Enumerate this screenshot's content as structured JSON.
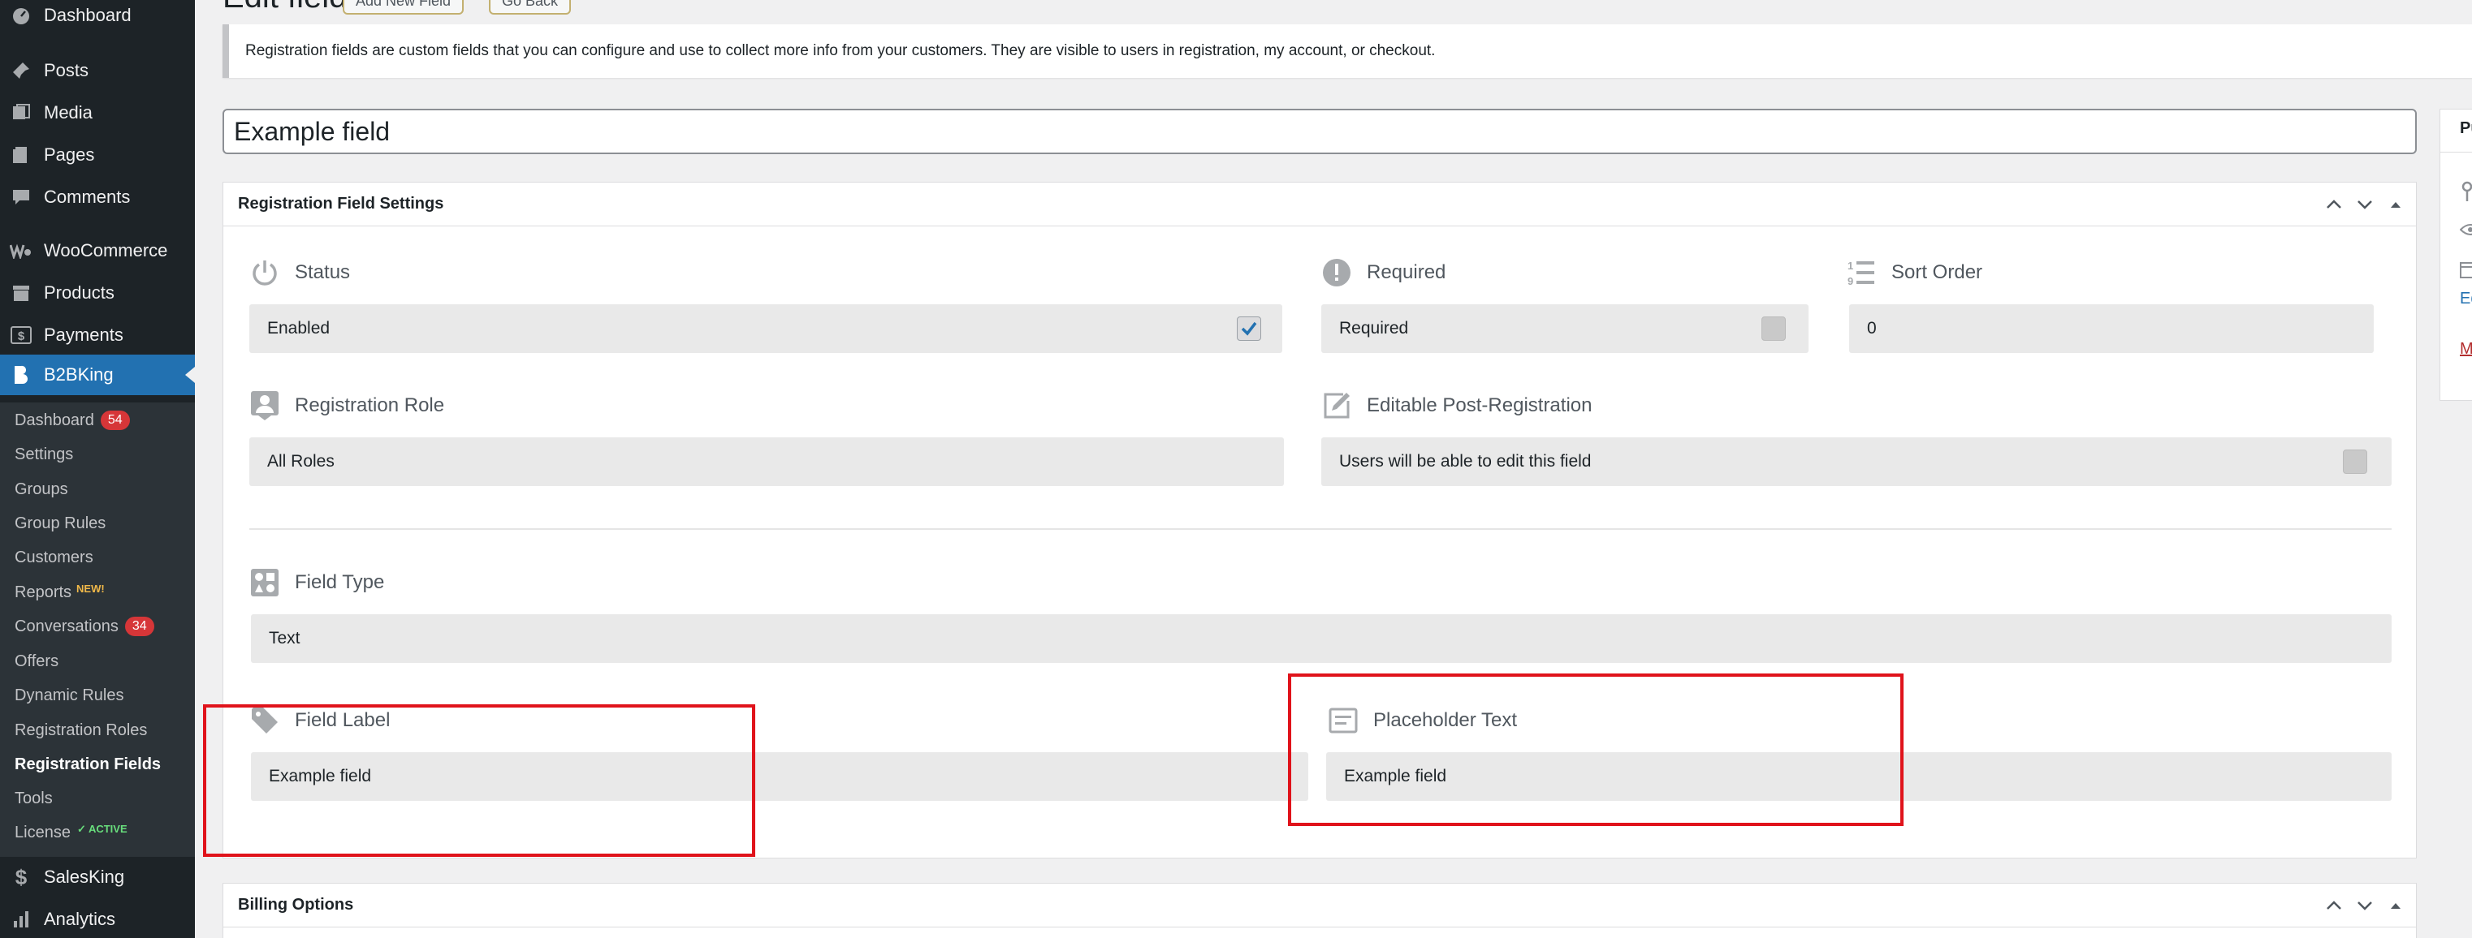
{
  "sidebar": {
    "items": [
      {
        "label": "Dashboard",
        "icon": "dashboard-icon"
      },
      {
        "label": "Posts",
        "icon": "pin-icon"
      },
      {
        "label": "Media",
        "icon": "media-icon"
      },
      {
        "label": "Pages",
        "icon": "pages-icon"
      },
      {
        "label": "Comments",
        "icon": "comment-icon"
      },
      {
        "label": "WooCommerce",
        "icon": "woocommerce-icon"
      },
      {
        "label": "Products",
        "icon": "archive-icon"
      },
      {
        "label": "Payments",
        "icon": "payments-icon"
      },
      {
        "label": "B2BKing",
        "icon": "b2bking-icon"
      },
      {
        "label": "SalesKing",
        "icon": "salesking-icon"
      },
      {
        "label": "Analytics",
        "icon": "bar-chart-icon"
      }
    ],
    "submenu": [
      {
        "label": "Dashboard",
        "badge": "54"
      },
      {
        "label": "Settings"
      },
      {
        "label": "Groups"
      },
      {
        "label": "Group Rules"
      },
      {
        "label": "Customers"
      },
      {
        "label": "Reports",
        "tag": "NEW!"
      },
      {
        "label": "Conversations",
        "badge": "34"
      },
      {
        "label": "Offers"
      },
      {
        "label": "Dynamic Rules"
      },
      {
        "label": "Registration Roles"
      },
      {
        "label": "Registration Fields"
      },
      {
        "label": "Tools"
      },
      {
        "label": "License",
        "tag": "✓ ACTIVE"
      }
    ]
  },
  "header": {
    "title": "Edit field",
    "add_new_label": "Add New Field",
    "go_back_label": "Go Back"
  },
  "notice": "Registration fields are custom fields that you can configure and use to collect more info from your customers. They are visible to users in registration, my account, or checkout.",
  "title_input": {
    "value": "Example field"
  },
  "settings_box": {
    "title": "Registration Field Settings",
    "status": {
      "label": "Status",
      "value": "Enabled",
      "checked": true
    },
    "required": {
      "label": "Required",
      "value": "Required",
      "checked": false
    },
    "sort_order": {
      "label": "Sort Order",
      "value": "0"
    },
    "registration_role": {
      "label": "Registration Role",
      "value": "All Roles"
    },
    "editable": {
      "label": "Editable Post-Registration",
      "value": "Users will be able to edit this field",
      "checked": false
    },
    "field_type": {
      "label": "Field Type",
      "value": "Text"
    },
    "field_label": {
      "label": "Field Label",
      "value": "Example field"
    },
    "placeholder": {
      "label": "Placeholder Text",
      "value": "Example field"
    }
  },
  "billing_box": {
    "title": "Billing Options"
  },
  "publish_box": {
    "title_partial": "Pu",
    "link_partial": "Ed",
    "trash_partial": "Mo"
  },
  "colors": {
    "accent": "#2271b1",
    "sidebar": "#1d2327",
    "highlight": "#e0131b"
  }
}
